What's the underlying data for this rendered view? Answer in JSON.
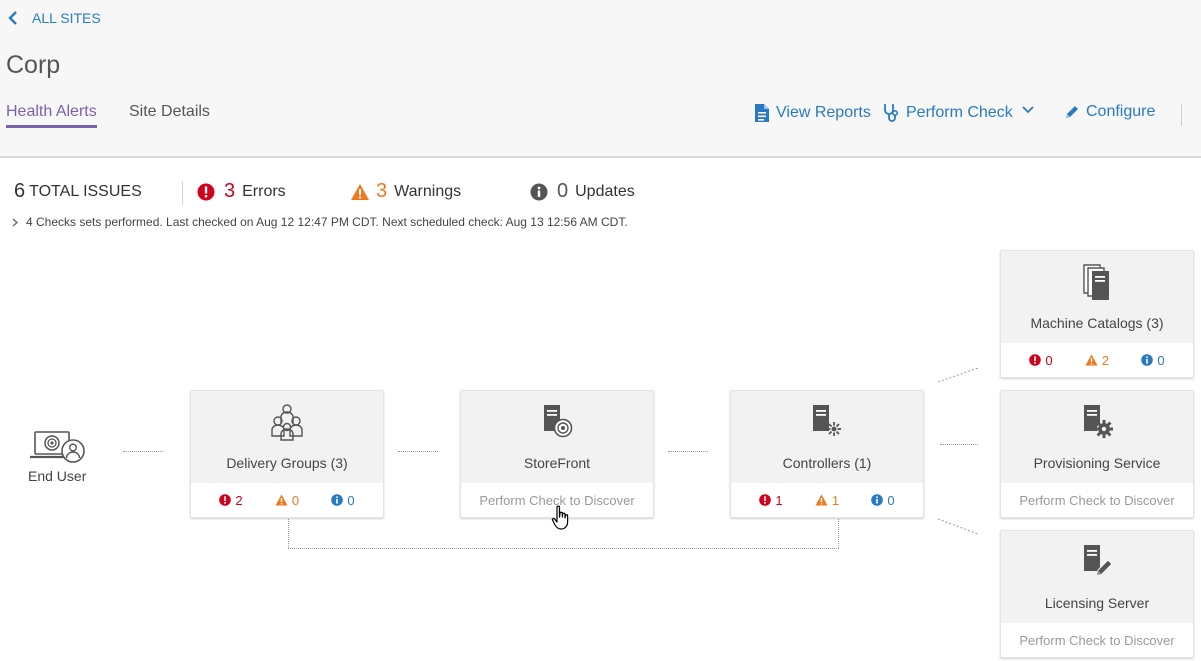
{
  "header": {
    "back_label": "ALL SITES",
    "title": "Corp",
    "tabs": [
      {
        "label": "Health Alerts",
        "active": true
      },
      {
        "label": "Site Details",
        "active": false
      }
    ],
    "actions": {
      "view_reports": "View Reports",
      "perform_check": "Perform Check",
      "configure": "Configure"
    }
  },
  "summary": {
    "total": "6",
    "total_label": "TOTAL ISSUES",
    "errors": "3",
    "errors_label": "Errors",
    "warnings": "3",
    "warnings_label": "Warnings",
    "updates": "0",
    "updates_label": "Updates",
    "check_info": "4 Checks sets performed. Last checked on Aug 12 12:47 PM CDT. Next scheduled check: Aug 13 12:56 AM CDT."
  },
  "topology": {
    "end_user": "End User",
    "discover_msg": "Perform Check to Discover",
    "delivery_groups": {
      "name": "Delivery Groups (3)",
      "errors": "2",
      "warnings": "0",
      "updates": "0"
    },
    "storefront": {
      "name": "StoreFront"
    },
    "controllers": {
      "name": "Controllers (1)",
      "errors": "1",
      "warnings": "1",
      "updates": "0"
    },
    "machine_catalogs": {
      "name": "Machine Catalogs (3)",
      "errors": "0",
      "warnings": "2",
      "updates": "0"
    },
    "provisioning": {
      "name": "Provisioning Service"
    },
    "licensing": {
      "name": "Licensing Server"
    }
  },
  "colors": {
    "accent": "#7b62a8",
    "link": "#2a7ac0",
    "error": "#d0021b",
    "warning": "#f0781e",
    "info": "#2a7ac0"
  }
}
